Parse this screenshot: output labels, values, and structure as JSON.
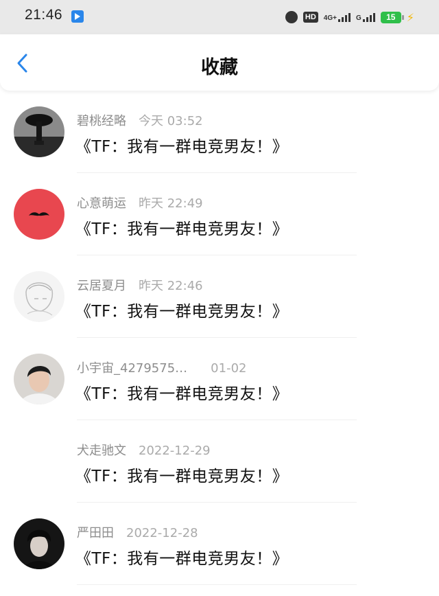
{
  "status_bar": {
    "time": "21:46",
    "network": "4G+",
    "signal_2": "G",
    "hd_label": "HD",
    "battery": "15"
  },
  "header": {
    "back_icon": "chevron-left-icon",
    "title": "收藏"
  },
  "colors": {
    "accent": "#2a86ea",
    "red_avatar": "#e8474f",
    "battery_green": "#2fbf4a"
  },
  "items": [
    {
      "name": "碧桃经略",
      "time": "今天 03:52",
      "title": "《TF：我有一群电竞男友！》",
      "avatar": "dark-silhouette-avatar"
    },
    {
      "name": "心意萌运",
      "time": "昨天 22:49",
      "title": "《TF：我有一群电竞男友！》",
      "avatar": "mustache-avatar"
    },
    {
      "name": "云居夏月",
      "time": "昨天 22:46",
      "title": "《TF：我有一群电竞男友！》",
      "avatar": "sketch-avatar"
    },
    {
      "name": "小宇宙_4279575…",
      "time": "01-02",
      "title": "《TF：我有一群电竞男友！》",
      "avatar": "photo-avatar"
    },
    {
      "name": "犬走驰文",
      "time": "2022-12-29",
      "title": "《TF：我有一群电竞男友！》",
      "avatar": ""
    },
    {
      "name": "严田田",
      "time": "2022-12-28",
      "title": "《TF：我有一群电竞男友！》",
      "avatar": "dark-portrait-avatar"
    }
  ]
}
